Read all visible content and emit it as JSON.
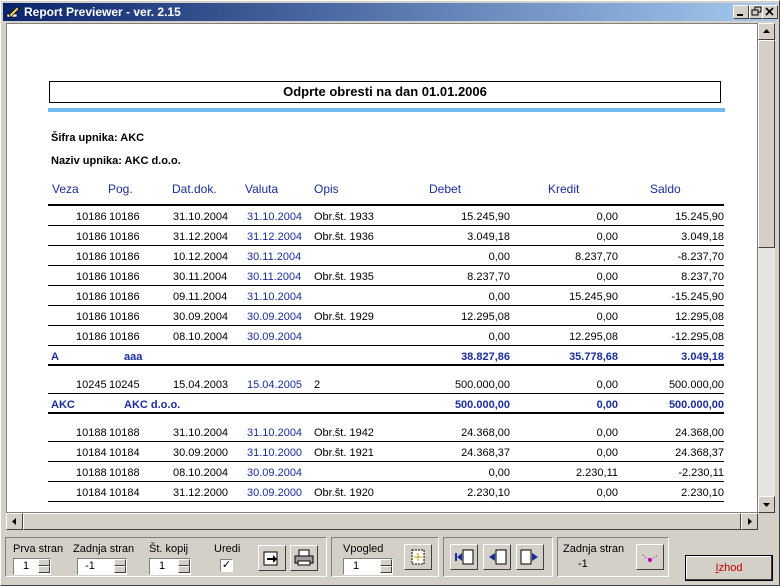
{
  "window": {
    "title": "Report Previewer - ver. 2.15"
  },
  "report": {
    "title": "Odprte obresti na dan  01.01.2006",
    "sifra_label": "Šifra upnika: AKC",
    "naziv_label": "Naziv upnika: AKC d.o.o.",
    "headers": [
      "Veza",
      "Pog.",
      "Dat.dok.",
      "Valuta",
      "Opis",
      "Debet",
      "Kredit",
      "Saldo"
    ],
    "rows": [
      {
        "type": "data",
        "veza": "10186",
        "pog": "10186",
        "dat": "31.10.2004",
        "valuta": "31.10.2004",
        "opis": "Obr.št.  1933",
        "debet": "15.245,90",
        "kredit": "0,00",
        "saldo": "15.245,90"
      },
      {
        "type": "data",
        "veza": "10186",
        "pog": "10186",
        "dat": "31.12.2004",
        "valuta": "31.12.2004",
        "opis": "Obr.št.  1936",
        "debet": "3.049,18",
        "kredit": "0,00",
        "saldo": "3.049,18"
      },
      {
        "type": "data",
        "veza": "10186",
        "pog": "10186",
        "dat": "10.12.2004",
        "valuta": "30.11.2004",
        "opis": "",
        "debet": "0,00",
        "kredit": "8.237,70",
        "saldo": "-8.237,70"
      },
      {
        "type": "data",
        "veza": "10186",
        "pog": "10186",
        "dat": "30.11.2004",
        "valuta": "30.11.2004",
        "opis": "Obr.št.  1935",
        "debet": "8.237,70",
        "kredit": "0,00",
        "saldo": "8.237,70"
      },
      {
        "type": "data",
        "veza": "10186",
        "pog": "10186",
        "dat": "09.11.2004",
        "valuta": "31.10.2004",
        "opis": "",
        "debet": "0,00",
        "kredit": "15.245,90",
        "saldo": "-15.245,90"
      },
      {
        "type": "data",
        "veza": "10186",
        "pog": "10186",
        "dat": "30.09.2004",
        "valuta": "30.09.2004",
        "opis": "Obr.št.  1929",
        "debet": "12.295,08",
        "kredit": "0,00",
        "saldo": "12.295,08"
      },
      {
        "type": "data",
        "veza": "10186",
        "pog": "10186",
        "dat": "08.10.2004",
        "valuta": "30.09.2004",
        "opis": "",
        "debet": "0,00",
        "kredit": "12.295,08",
        "saldo": "-12.295,08"
      },
      {
        "type": "sum",
        "veza": "A",
        "pog": "aaa",
        "debet": "38.827,86",
        "kredit": "35.778,68",
        "saldo": "3.049,18"
      },
      {
        "type": "data",
        "veza": "10245",
        "pog": "10245",
        "dat": "15.04.2003",
        "valuta": "15.04.2005",
        "opis": "2",
        "debet": "500.000,00",
        "kredit": "0,00",
        "saldo": "500.000,00"
      },
      {
        "type": "sum",
        "veza": "AKC",
        "pog": "AKC d.o.o.",
        "debet": "500.000,00",
        "kredit": "0,00",
        "saldo": "500.000,00"
      },
      {
        "type": "data",
        "veza": "10188",
        "pog": "10188",
        "dat": "31.10.2004",
        "valuta": "31.10.2004",
        "opis": "Obr.št.  1942",
        "debet": "24.368,00",
        "kredit": "0,00",
        "saldo": "24.368,00"
      },
      {
        "type": "data",
        "veza": "10184",
        "pog": "10184",
        "dat": "30.09.2000",
        "valuta": "31.10.2000",
        "opis": "Obr.št.        1921",
        "debet": "24.368,37",
        "kredit": "0,00",
        "saldo": "24.368,37"
      },
      {
        "type": "data",
        "veza": "10188",
        "pog": "10188",
        "dat": "08.10.2004",
        "valuta": "30.09.2004",
        "opis": "",
        "debet": "0,00",
        "kredit": "2.230,11",
        "saldo": "-2.230,11"
      },
      {
        "type": "data",
        "veza": "10184",
        "pog": "10184",
        "dat": "31.12.2000",
        "valuta": "30.09.2000",
        "opis": "Obr.št.        1920",
        "debet": "2.230,10",
        "kredit": "0,00",
        "saldo": "2.230,10"
      }
    ]
  },
  "toolbar": {
    "prva_stran_label": "Prva stran",
    "prva_stran_value": "1",
    "zadnja_stran_label": "Zadnja stran",
    "zadnja_stran_value": "-1",
    "st_kopij_label": "Št. kopij",
    "st_kopij_value": "1",
    "uredi_label": "Uredi",
    "uredi_checked": "✓",
    "vpogled_label": "Vpogled",
    "vpogled_value": "1",
    "zadnja_stran2_label": "Zadnja stran",
    "zadnja_stran2_value": "-1",
    "exit_hotkey": "I",
    "exit_rest": "zhod"
  },
  "colors": {
    "title_start": "#0a246a",
    "title_end": "#a6caf0",
    "header_blue": "#1a2d9a",
    "rule_blue": "#6fbaf0",
    "exit_red": "#c00000"
  }
}
